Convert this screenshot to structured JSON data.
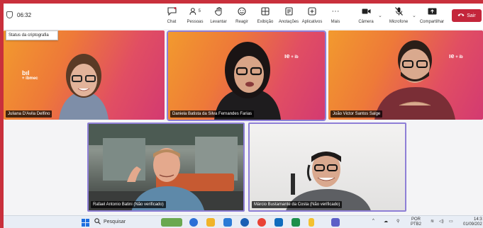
{
  "meeting": {
    "timer": "06:32",
    "tooltip": "Status da criptografia"
  },
  "toolbar": {
    "chat": "Chat",
    "people": "Pessoas",
    "people_count": "5",
    "raise": "Levantar",
    "react": "Reagir",
    "view": "Exibição",
    "notes": "Anotações",
    "apps": "Aplicativos",
    "more": "Mais",
    "camera": "Câmera",
    "mic": "Microfone",
    "share": "Compartilhar",
    "leave": "Sair"
  },
  "participants": [
    {
      "name": "Juliana D'Avila Delfino"
    },
    {
      "name": "Daniela Batista da Silva Fernandes Farias"
    },
    {
      "name": "João Victor Santos Salge"
    },
    {
      "name": "Rafael Antonio Batini (Não verificado)"
    },
    {
      "name": "Márcio Bustamante da Costa (Não verificado)"
    }
  ],
  "branding": {
    "brand_a": "bıl",
    "brand_a_sub": "+ ibmec",
    "brand_b": "ıe",
    "brand_b_sub": "+",
    "brand_b_sub2": "ib"
  },
  "taskbar": {
    "search": "Pesquisar",
    "lang_top": "POR",
    "lang_bottom": "PTB2",
    "time": "14:3",
    "date": "01/09/202"
  },
  "colors": {
    "frame": "#c9303c",
    "active_border": "#8e7fd6",
    "leave": "#c4263b"
  }
}
